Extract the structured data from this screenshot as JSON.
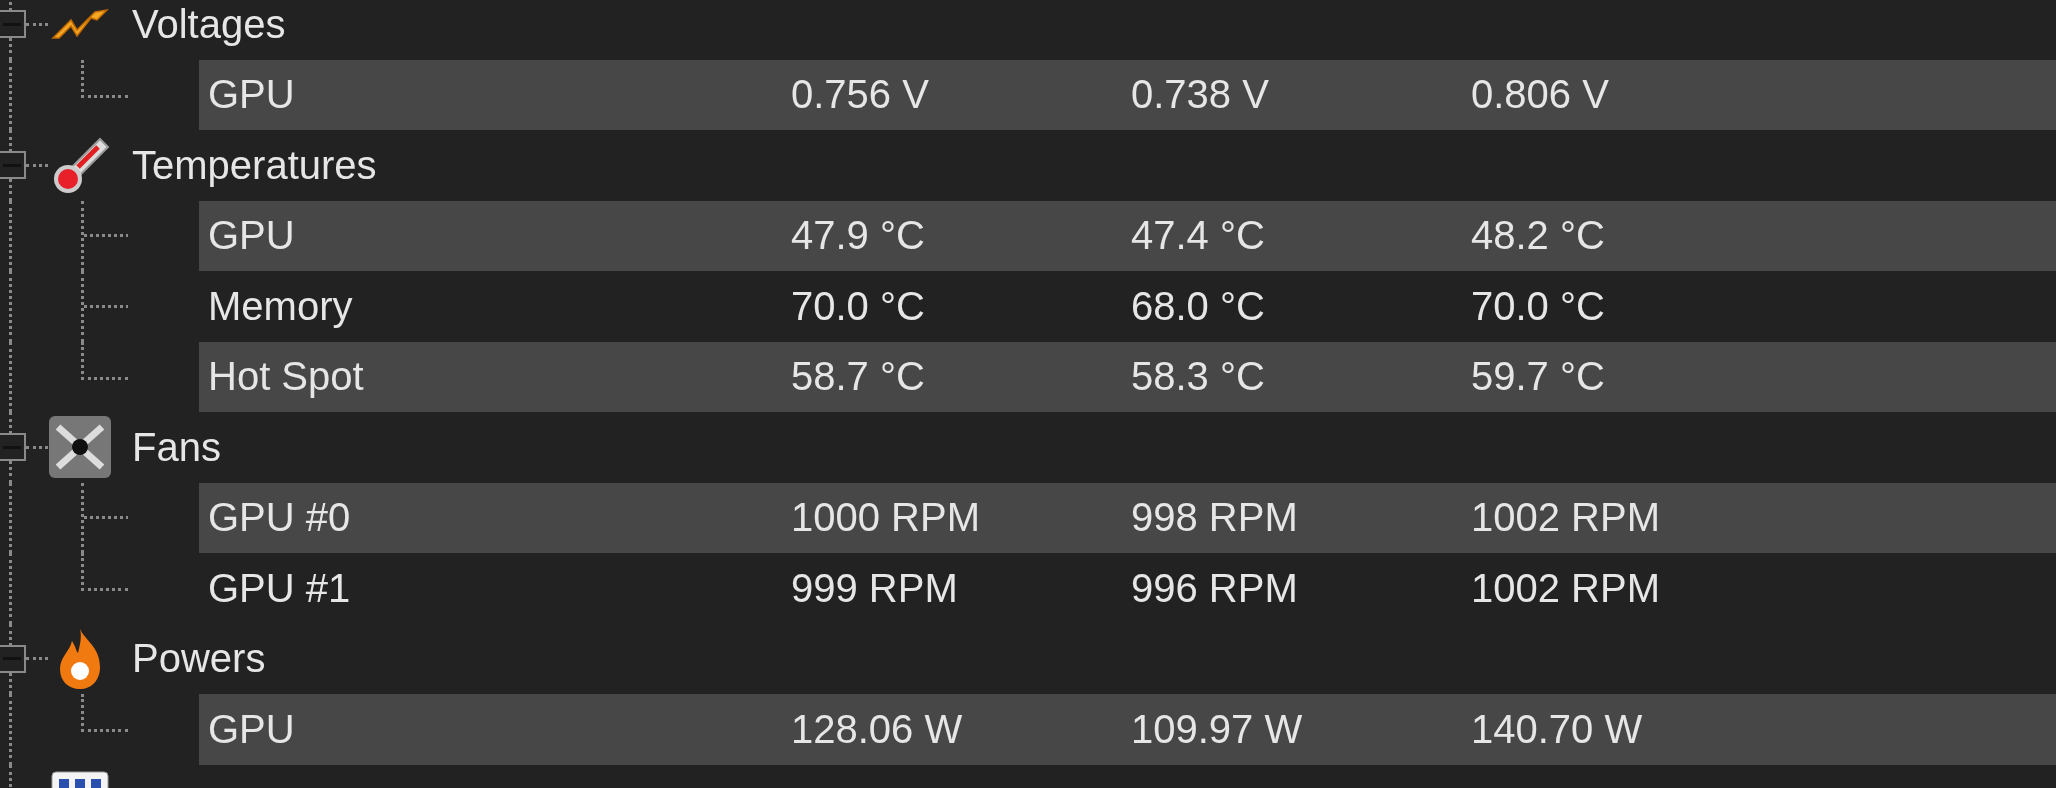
{
  "groups": [
    {
      "kind": "voltages",
      "label": "Voltages",
      "expanded": true,
      "sensors": [
        {
          "name": "GPU",
          "cells": [
            "0.756 V",
            "0.738 V",
            "0.806 V"
          ]
        }
      ]
    },
    {
      "kind": "temperatures",
      "label": "Temperatures",
      "expanded": true,
      "sensors": [
        {
          "name": "GPU",
          "cells": [
            "47.9 °C",
            "47.4 °C",
            "48.2 °C"
          ]
        },
        {
          "name": "Memory",
          "cells": [
            "70.0 °C",
            "68.0 °C",
            "70.0 °C"
          ]
        },
        {
          "name": "Hot Spot",
          "cells": [
            "58.7 °C",
            "58.3 °C",
            "59.7 °C"
          ]
        }
      ]
    },
    {
      "kind": "fans",
      "label": "Fans",
      "expanded": true,
      "sensors": [
        {
          "name": "GPU #0",
          "cells": [
            "1000 RPM",
            "998 RPM",
            "1002 RPM"
          ]
        },
        {
          "name": "GPU #1",
          "cells": [
            "999 RPM",
            "996 RPM",
            "1002 RPM"
          ]
        }
      ]
    },
    {
      "kind": "powers",
      "label": "Powers",
      "expanded": true,
      "sensors": [
        {
          "name": "GPU",
          "cells": [
            "128.06 W",
            "109.97 W",
            "140.70 W"
          ]
        }
      ]
    },
    {
      "kind": "clocks"
    }
  ]
}
